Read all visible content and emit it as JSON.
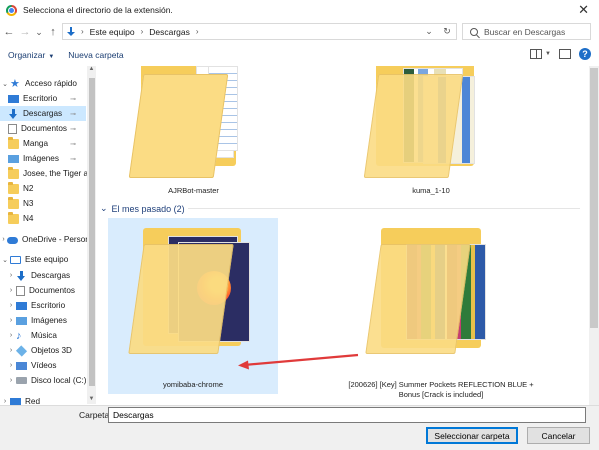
{
  "window": {
    "title": "Selecciona el directorio de la extensión.",
    "close_glyph": "✕"
  },
  "nav": {
    "back": "←",
    "forward": "→",
    "recent": "⌄",
    "up": "↑"
  },
  "address": {
    "crumbs": [
      "Este equipo",
      "Descargas"
    ],
    "sep": "›",
    "dropdown": "⌄",
    "refresh": "↻"
  },
  "search": {
    "placeholder": "Buscar en Descargas"
  },
  "toolbar": {
    "organize": "Organizar",
    "new_folder": "Nueva carpeta",
    "caret": "▼",
    "help": "?"
  },
  "sidebar": {
    "items": [
      {
        "label": "Acceso rápido",
        "icon": "star-icon",
        "chev": "⌄",
        "pinned": false
      },
      {
        "label": "Escritorio",
        "icon": "desktop-icon",
        "chev": "",
        "pinned": true
      },
      {
        "label": "Descargas",
        "icon": "download-icon",
        "chev": "",
        "pinned": true,
        "selected": true
      },
      {
        "label": "Documentos",
        "icon": "document-icon",
        "chev": "",
        "pinned": true
      },
      {
        "label": "Manga",
        "icon": "folder-icon",
        "chev": "",
        "pinned": true
      },
      {
        "label": "Imágenes",
        "icon": "pictures-icon",
        "chev": "",
        "pinned": true
      },
      {
        "label": "Josee, the Tiger a",
        "icon": "folder-icon",
        "chev": "",
        "pinned": false
      },
      {
        "label": "N2",
        "icon": "folder-icon",
        "chev": "",
        "pinned": false
      },
      {
        "label": "N3",
        "icon": "folder-icon",
        "chev": "",
        "pinned": false
      },
      {
        "label": "N4",
        "icon": "folder-icon",
        "chev": "",
        "pinned": false
      },
      {
        "label": "OneDrive - Persor",
        "icon": "cloud-icon",
        "chev": "›",
        "pinned": false
      },
      {
        "label": "Este equipo",
        "icon": "computer-icon",
        "chev": "⌄",
        "pinned": false
      },
      {
        "label": "Descargas",
        "icon": "download-icon",
        "chev": "›",
        "pinned": false
      },
      {
        "label": "Documentos",
        "icon": "document-icon",
        "chev": "›",
        "pinned": false
      },
      {
        "label": "Escritorio",
        "icon": "desktop-icon",
        "chev": "›",
        "pinned": false
      },
      {
        "label": "Imágenes",
        "icon": "pictures-icon",
        "chev": "›",
        "pinned": false
      },
      {
        "label": "Música",
        "icon": "music-icon",
        "chev": "›",
        "pinned": false
      },
      {
        "label": "Objetos 3D",
        "icon": "objects-3d-icon",
        "chev": "›",
        "pinned": false
      },
      {
        "label": "Vídeos",
        "icon": "videos-icon",
        "chev": "›",
        "pinned": false
      },
      {
        "label": "Disco local (C:)",
        "icon": "disk-icon",
        "chev": "›",
        "pinned": false
      },
      {
        "label": "Red",
        "icon": "network-icon",
        "chev": "›",
        "pinned": false
      }
    ],
    "pin_glyph": "📌",
    "scroll_up": "▲",
    "scroll_down": "▼"
  },
  "content": {
    "group_label": "El mes pasado (2)",
    "group_chevron": "⌄",
    "folders": [
      {
        "name": "AJRBot-master",
        "selected": false
      },
      {
        "name": "kuma_1-10",
        "selected": false
      },
      {
        "name": "yomibaba-chrome",
        "selected": true
      },
      {
        "name": "[200626] [Key] Summer Pockets REFLECTION BLUE + Bonus [Crack is included]",
        "selected": false
      }
    ]
  },
  "footer": {
    "folder_label": "Carpeta:",
    "folder_value": "Descargas",
    "select_button": "Seleccionar carpeta",
    "cancel_button": "Cancelar"
  }
}
